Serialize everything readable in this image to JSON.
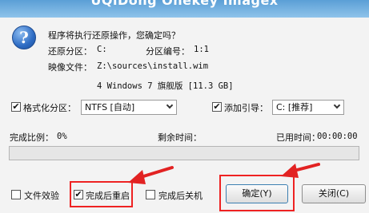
{
  "window": {
    "title": "UQiDong Onekey Imagex"
  },
  "icons": {
    "question": "question-mark-icon"
  },
  "question": {
    "prompt": "程序将执行还原操作，您确定吗？",
    "glyph": "?"
  },
  "info": {
    "restore_partition_label": "还原分区：",
    "restore_partition_value": "C:",
    "partition_number_label": "分区编号：",
    "partition_number_value": "1:1",
    "image_file_label": "映像文件：",
    "image_file_value": "Z:\\sources\\install.wim",
    "image_detail": "4 Windows 7 旗舰版 [11.3 GB]"
  },
  "options": {
    "format_partition": {
      "label": "格式化分区：",
      "checked": true,
      "check_glyph": "✔",
      "select_value": "NTFS [自动]"
    },
    "add_boot": {
      "label": "添加引导：",
      "checked": true,
      "check_glyph": "✔",
      "select_value": "C: [推荐]"
    }
  },
  "progress": {
    "ratio_label": "完成比例：",
    "ratio_value": "0%",
    "percent": 0,
    "remaining_label": "剩余时间：",
    "remaining_value": "",
    "elapsed_label": "已用时间：",
    "elapsed_value": "00:00:00"
  },
  "footer": {
    "verify_files": {
      "label": "文件效验",
      "checked": false,
      "check_glyph": ""
    },
    "restart_after": {
      "label": "完成后重启",
      "checked": true,
      "check_glyph": "✔"
    },
    "shutdown_after": {
      "label": "完成后关机",
      "checked": false,
      "check_glyph": ""
    },
    "ok_button": "确定(Y)",
    "close_button": "关闭(C)"
  },
  "colors": {
    "highlight": "#e22222",
    "progress_fill": "#3cb043",
    "title_bar": "#6aaee0"
  }
}
